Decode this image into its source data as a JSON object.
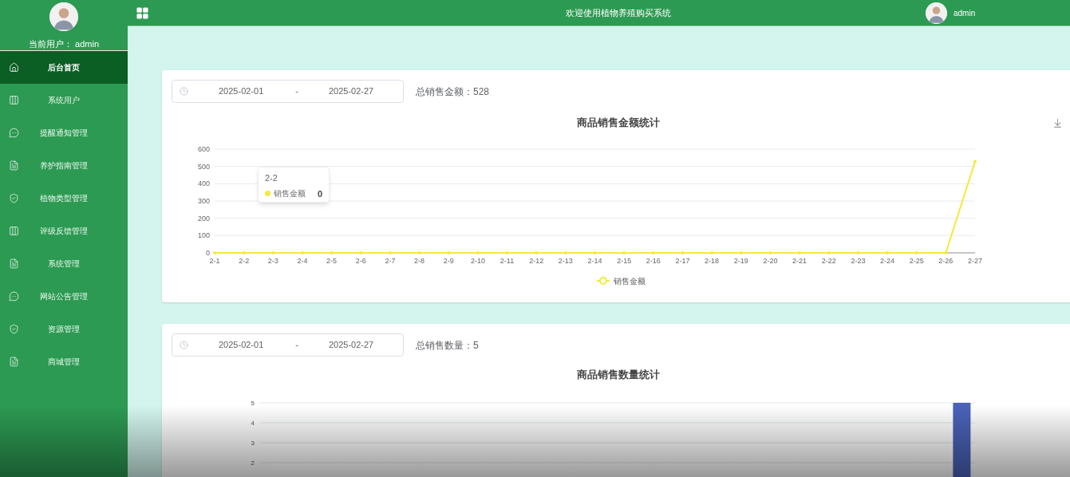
{
  "sidebar": {
    "user_label": "当前用户：",
    "user_name": "admin",
    "items": [
      {
        "label": "后台首页",
        "kind": "home",
        "selected": true
      },
      {
        "label": "系统用户",
        "kind": "columns",
        "selected": false
      },
      {
        "label": "提醒通知管理",
        "kind": "chat",
        "selected": false
      },
      {
        "label": "养护指南管理",
        "kind": "document",
        "selected": false
      },
      {
        "label": "植物类型管理",
        "kind": "shield",
        "selected": false
      },
      {
        "label": "评级反馈管理",
        "kind": "columns",
        "selected": false
      },
      {
        "label": "系统管理",
        "kind": "document",
        "selected": false
      },
      {
        "label": "网站公告管理",
        "kind": "chat",
        "selected": false
      },
      {
        "label": "资源管理",
        "kind": "shield",
        "selected": false
      },
      {
        "label": "商城管理",
        "kind": "document",
        "selected": false
      }
    ]
  },
  "header": {
    "title": "欢迎使用植物养殖购买系统",
    "user_name": "admin"
  },
  "cards": [
    {
      "start_date": "2025-02-01",
      "separator": "-",
      "end_date": "2025-02-27",
      "total_label": "总销售金额：",
      "total_value": "528",
      "tooltip": {
        "title": "2-2",
        "series": "销售金额",
        "value": "0"
      },
      "chart_data": {
        "type": "line",
        "title": "商品销售金额统计",
        "categories": [
          "2-1",
          "2-2",
          "2-3",
          "2-4",
          "2-5",
          "2-6",
          "2-7",
          "2-8",
          "2-9",
          "2-10",
          "2-11",
          "2-12",
          "2-13",
          "2-14",
          "2-15",
          "2-16",
          "2-17",
          "2-18",
          "2-19",
          "2-20",
          "2-21",
          "2-22",
          "2-23",
          "2-24",
          "2-25",
          "2-26",
          "2-27"
        ],
        "series": [
          {
            "name": "销售金额",
            "color": "#f5e93b",
            "values": [
              0,
              0,
              0,
              0,
              0,
              0,
              0,
              0,
              0,
              0,
              0,
              0,
              0,
              0,
              0,
              0,
              0,
              0,
              0,
              0,
              0,
              0,
              0,
              0,
              0,
              0,
              528
            ]
          }
        ],
        "ylim": [
          0,
          600
        ],
        "yticks": [
          0,
          100,
          200,
          300,
          400,
          500,
          600
        ],
        "grid": true
      }
    },
    {
      "start_date": "2025-02-01",
      "separator": "-",
      "end_date": "2025-02-27",
      "total_label": "总销售数量：",
      "total_value": "5",
      "chart_data": {
        "type": "bar",
        "title": "商品销售数量统计",
        "series": [
          {
            "color": "#4a62b8",
            "values": [
              0,
              0,
              0,
              0,
              0,
              0,
              0,
              0,
              0,
              0,
              0,
              0,
              0,
              0,
              0,
              0,
              0,
              0,
              0,
              0,
              0,
              0,
              0,
              0,
              0,
              0,
              5
            ]
          }
        ],
        "ylim": [
          0,
          5
        ],
        "yticks": [
          2,
          3,
          4,
          5
        ],
        "grid": true
      }
    }
  ]
}
